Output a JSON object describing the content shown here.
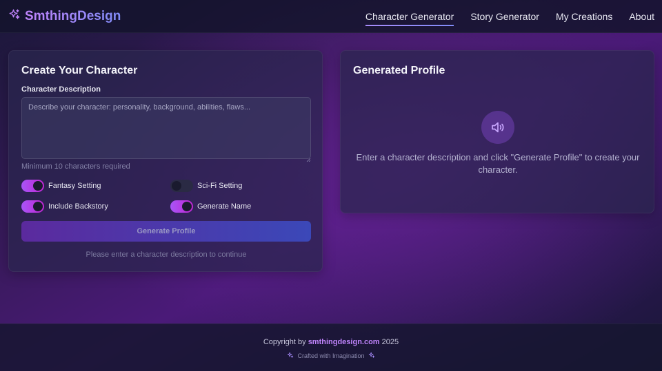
{
  "brand": {
    "name": "SmthingDesign",
    "icon": "sparkles-icon"
  },
  "nav": {
    "items": [
      {
        "label": "Character Generator",
        "active": true
      },
      {
        "label": "Story Generator",
        "active": false
      },
      {
        "label": "My Creations",
        "active": false
      },
      {
        "label": "About",
        "active": false
      }
    ]
  },
  "create_card": {
    "title": "Create Your Character",
    "description_label": "Character Description",
    "description_value": "",
    "description_placeholder": "Describe your character: personality, background, abilities, flaws...",
    "hint": "Minimum 10 characters required",
    "options": [
      {
        "label": "Fantasy Setting",
        "on": true
      },
      {
        "label": "Sci-Fi Setting",
        "on": false
      },
      {
        "label": "Include Backstory",
        "on": true
      },
      {
        "label": "Generate Name",
        "on": true
      }
    ],
    "generate_label": "Generate Profile",
    "status": "Please enter a character description to continue"
  },
  "profile_card": {
    "title": "Generated Profile",
    "icon": "speaker-icon",
    "empty_message": "Enter a character description and click \"Generate Profile\" to create your character."
  },
  "footer": {
    "copyright_prefix": "Copyright by",
    "site": "smthingdesign.com",
    "year": "2025",
    "tagline": "Crafted with Imagination"
  },
  "colors": {
    "accent": "#a855f7",
    "brand_gradient_start": "#c084fc",
    "brand_gradient_end": "#818cf8",
    "toggle_off": "#2a2a44"
  }
}
